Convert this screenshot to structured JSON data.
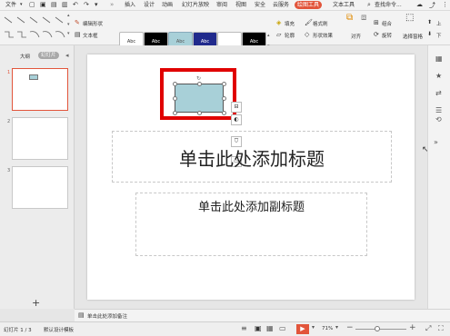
{
  "menubar": {
    "file": "文件",
    "tabs": [
      "插入",
      "设计",
      "动画",
      "幻灯片放映",
      "审阅",
      "视图",
      "安全",
      "云服务"
    ],
    "active_tab": "绘图工具",
    "text_tool": "文本工具",
    "search": "查找命令..."
  },
  "ribbon": {
    "edit_shape": "编辑形状",
    "text_box": "文本框",
    "style_label": "Abc",
    "fill": "填充",
    "format_painter": "格式刷",
    "outline": "轮廓",
    "shape_effect": "形状效果",
    "group": "组合",
    "rotate": "旋转",
    "align": "对齐",
    "select_pane": "选择窗格",
    "up": "上",
    "down": "下"
  },
  "leftpane": {
    "tab_outline": "大纲",
    "tab_slides": "幻灯片",
    "slide_numbers": [
      "1",
      "2",
      "3"
    ],
    "add_button": "+"
  },
  "slide": {
    "title_placeholder": "单击此处添加标题",
    "subtitle_placeholder": "单击此处添加副标题"
  },
  "notes": {
    "placeholder": "单击此处添加备注"
  },
  "status": {
    "slide_indicator": "幻灯片 1 / 3",
    "theme": "默认设计模板",
    "zoom": "71%"
  },
  "colors": {
    "accent": "#e2553b",
    "highlight_box": "#e00000",
    "shape_fill": "#a8d0d8"
  }
}
